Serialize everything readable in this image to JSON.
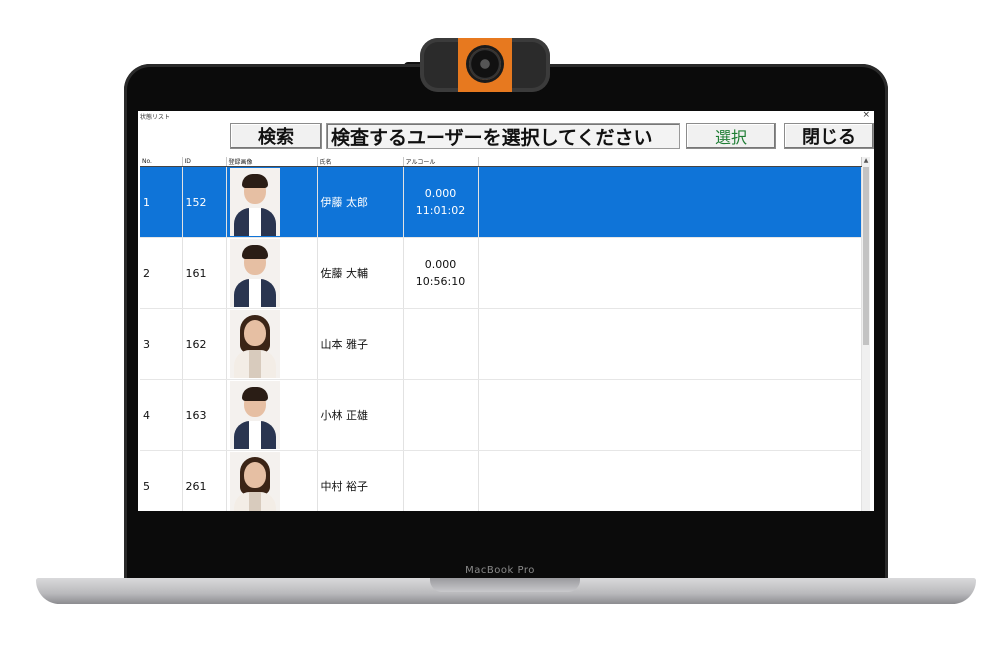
{
  "window": {
    "title": "状態リスト",
    "close_glyph": "×"
  },
  "toolbar": {
    "search_label": "検索",
    "prompt_text": "検査するユーザーを選択してください",
    "select_label": "選択",
    "close_label": "閉じる",
    "select_color": "#1e7d34"
  },
  "table": {
    "headers": {
      "no": "No.",
      "id": "ID",
      "photo": "登録画像",
      "name": "氏名",
      "alcohol": "アルコール"
    },
    "rows": [
      {
        "no": "1",
        "id": "152",
        "name": "伊藤 太郎",
        "alcohol": "0.000",
        "time": "11:01:02",
        "selected": true,
        "photo": "male-portrait"
      },
      {
        "no": "2",
        "id": "161",
        "name": "佐藤 大輔",
        "alcohol": "0.000",
        "time": "10:56:10",
        "selected": false,
        "photo": "male-portrait"
      },
      {
        "no": "3",
        "id": "162",
        "name": "山本 雅子",
        "alcohol": "",
        "time": "",
        "selected": false,
        "photo": "female-portrait"
      },
      {
        "no": "4",
        "id": "163",
        "name": "小林 正雄",
        "alcohol": "",
        "time": "",
        "selected": false,
        "photo": "male-portrait"
      },
      {
        "no": "5",
        "id": "261",
        "name": "中村 裕子",
        "alcohol": "",
        "time": "",
        "selected": false,
        "photo": "female-portrait"
      }
    ],
    "selection_color": "#0f74d8"
  },
  "device": {
    "brand": "MacBook Pro",
    "accessory": "webcam-icon"
  }
}
